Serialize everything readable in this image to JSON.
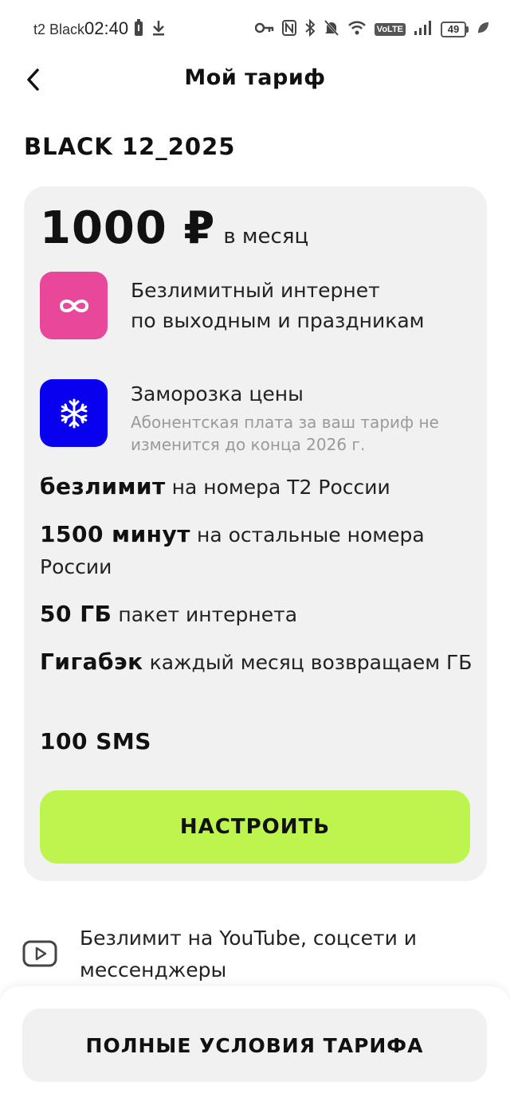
{
  "status_bar": {
    "carrier": "t2 Black",
    "time": "02:40",
    "volte": "VoLTE",
    "battery_level": "49",
    "icons": [
      "battery-saver-icon",
      "download-icon",
      "key-icon",
      "nfc-icon",
      "bluetooth-icon",
      "mute-icon",
      "wifi-icon",
      "volte-icon",
      "signal-icon",
      "battery-icon",
      "leaf-icon"
    ]
  },
  "header": {
    "title": "Мой тариф",
    "back_icon": "chevron-left-icon"
  },
  "tariff": {
    "name": "BLACK 12_2025",
    "price": "1000 ₽",
    "period": "в месяц"
  },
  "features": [
    {
      "icon": "infinity-icon",
      "color": "#e8479a",
      "line1": "Безлимитный интернет",
      "line2": "по выходным и праздникам"
    },
    {
      "icon": "snowflake-icon",
      "color": "#0a00f0",
      "title": "Заморозка цены",
      "desc": "Абонентская плата за ваш тариф не изменится до конца 2026 г."
    }
  ],
  "specs": [
    {
      "bold": "безлимит",
      "text": "на номера Т2 России"
    },
    {
      "bold": "1500 минут",
      "text": "на остальные номера России"
    },
    {
      "bold": "50 ГБ",
      "text": "пакет интернета"
    },
    {
      "bold": "Гигабэк",
      "text": "каждый месяц возвращаем ГБ"
    },
    {
      "bold": "100 SMS",
      "text": ""
    }
  ],
  "configure_button": "НАСТРОИТЬ",
  "extra": {
    "icon": "youtube-icon",
    "text": "Безлимит на YouTube, соцсети и мессенджеры"
  },
  "terms_button": "ПОЛНЫЕ УСЛОВИЯ ТАРИФА",
  "colors": {
    "accent_green": "#bdf54e",
    "infinity_pink": "#e8479a",
    "snowflake_blue": "#0a00f0",
    "card_bg": "#f1f1f1"
  }
}
